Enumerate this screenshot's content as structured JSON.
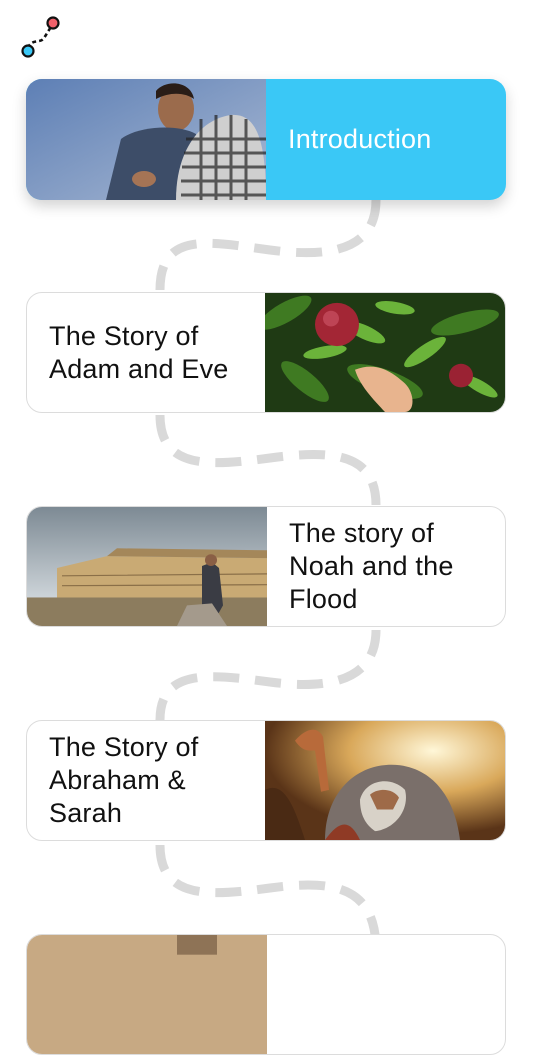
{
  "app": {
    "logo_icon": "route-path-icon"
  },
  "lessons": [
    {
      "title": "Introduction",
      "active": true,
      "image": "man-in-desert-photo"
    },
    {
      "title": "The Story of Adam and Eve",
      "active": false,
      "image": "pomegranate-tree-photo"
    },
    {
      "title": "The story of Noah and the Flood",
      "active": false,
      "image": "ark-and-man-photo"
    },
    {
      "title": "The Story of Abraham & Sarah",
      "active": false,
      "image": "abraham-illustration"
    }
  ],
  "colors": {
    "accent": "#3ac8f6",
    "path": "#d9d9d9",
    "logo_red": "#f0606a",
    "logo_blue": "#3ac8f6"
  }
}
